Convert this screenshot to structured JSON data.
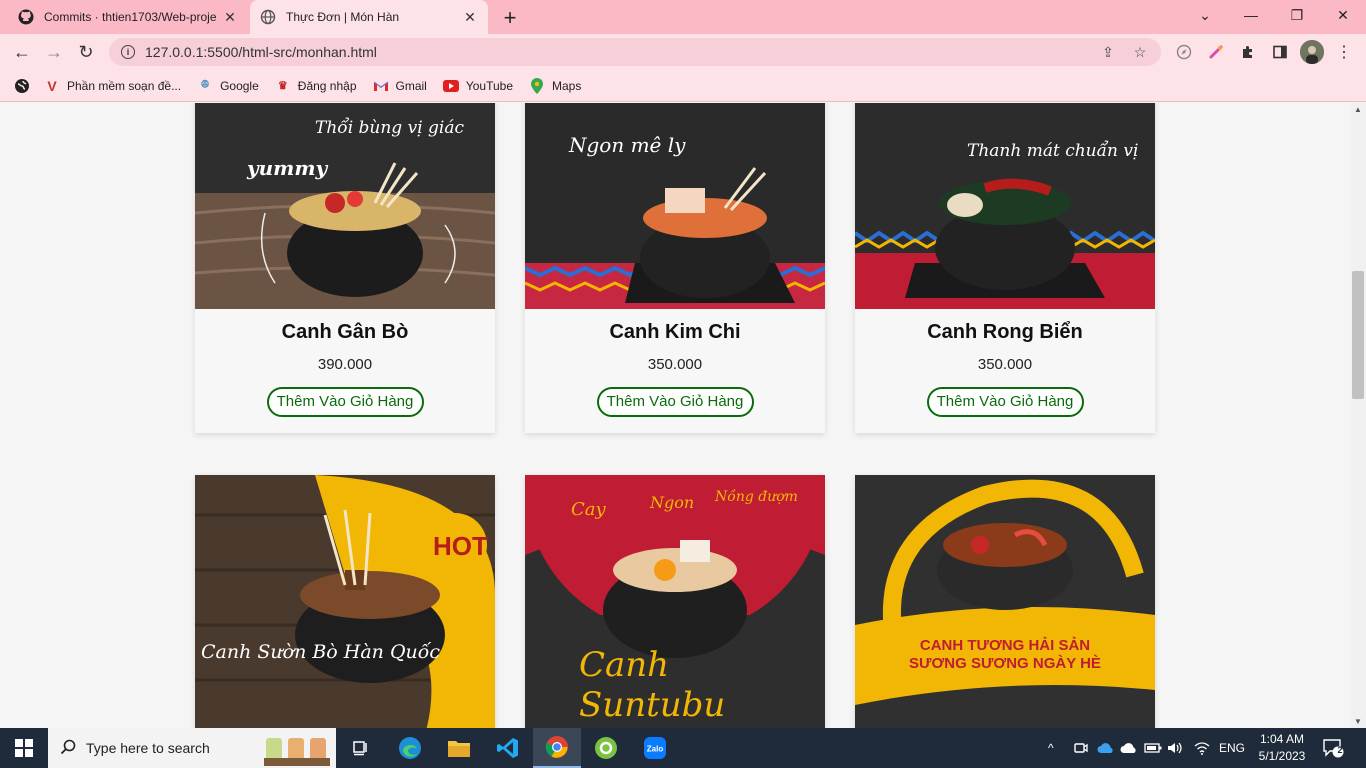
{
  "browser": {
    "tabs": [
      {
        "title": "Commits · thtien1703/Web-proje",
        "icon": "github-icon"
      },
      {
        "title": "Thực Đơn | Món Hàn",
        "icon": "globe-icon"
      }
    ],
    "url": "127.0.0.1:5500/html-src/monhan.html",
    "bookmarks": [
      {
        "label": "Phần mềm soạn đề...",
        "icon": "v-logo-icon"
      },
      {
        "label": "Google",
        "icon": "google-icon"
      },
      {
        "label": "Đăng nhập",
        "icon": "login-icon"
      },
      {
        "label": "Gmail",
        "icon": "gmail-icon"
      },
      {
        "label": "YouTube",
        "icon": "youtube-icon"
      },
      {
        "label": "Maps",
        "icon": "maps-icon"
      }
    ]
  },
  "products": [
    {
      "name": "Canh Gân Bò",
      "price": "390.000",
      "button": "Thêm Vào Giỏ Hàng",
      "image_text": [
        "Thổi bùng vị giác",
        "yummy"
      ]
    },
    {
      "name": "Canh Kim Chi",
      "price": "350.000",
      "button": "Thêm Vào Giỏ Hàng",
      "image_text": [
        "Ngon mê ly"
      ]
    },
    {
      "name": "Canh Rong Biển",
      "price": "350.000",
      "button": "Thêm Vào Giỏ Hàng",
      "image_text": [
        "Thanh mát chuẩn vị"
      ]
    },
    {
      "name": "",
      "price": "",
      "button": "",
      "image_text": [
        "HOT",
        "Canh Sườn Bò Hàn Quốc"
      ]
    },
    {
      "name": "",
      "price": "",
      "button": "",
      "image_text": [
        "Cay",
        "Ngon",
        "Nồng đượm",
        "Canh Suntubu"
      ]
    },
    {
      "name": "",
      "price": "",
      "button": "",
      "image_text": [
        "CANH TƯƠNG HẢI SẢN",
        "SƯƠNG SƯƠNG NGÀY HÈ"
      ]
    }
  ],
  "taskbar": {
    "search_placeholder": "Type here to search",
    "language": "ENG",
    "time": "1:04 AM",
    "date": "5/1/2023",
    "notification_count": "2"
  },
  "colors": {
    "tab_strip": "#fbb9c6",
    "toolbar": "#fde2e8",
    "button_green": "#0b6b0b",
    "taskbar": "#1f2b3a"
  }
}
